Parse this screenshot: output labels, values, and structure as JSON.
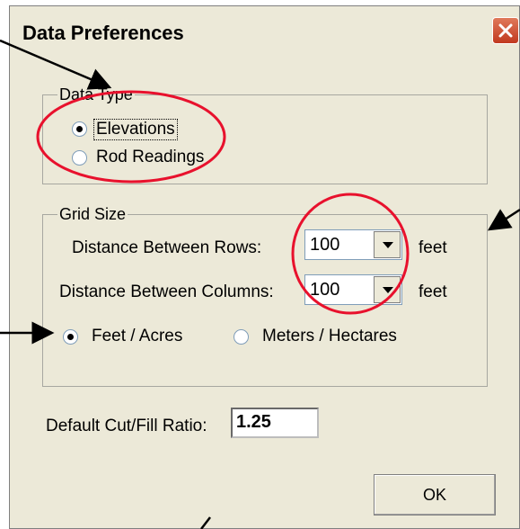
{
  "dialog": {
    "title": "Data Preferences",
    "close_icon": "close-icon"
  },
  "data_type": {
    "legend": "Data Type",
    "options": [
      {
        "label": "Elevations",
        "checked": true
      },
      {
        "label": "Rod Readings",
        "checked": false
      }
    ]
  },
  "grid_size": {
    "legend": "Grid Size",
    "rows_label": "Distance Between Rows:",
    "rows_value": "100",
    "rows_unit": "feet",
    "cols_label": "Distance Between Columns:",
    "cols_value": "100",
    "cols_unit": "feet",
    "units": [
      {
        "label": "Feet / Acres",
        "checked": true
      },
      {
        "label": "Meters / Hectares",
        "checked": false
      }
    ]
  },
  "cut_fill": {
    "label": "Default Cut/Fill Ratio:",
    "value": "1.25"
  },
  "ok_label": "OK",
  "colors": {
    "dialog_bg": "#ece9d8",
    "annotation_red": "#e8112d",
    "close_red": "#c1391f"
  }
}
